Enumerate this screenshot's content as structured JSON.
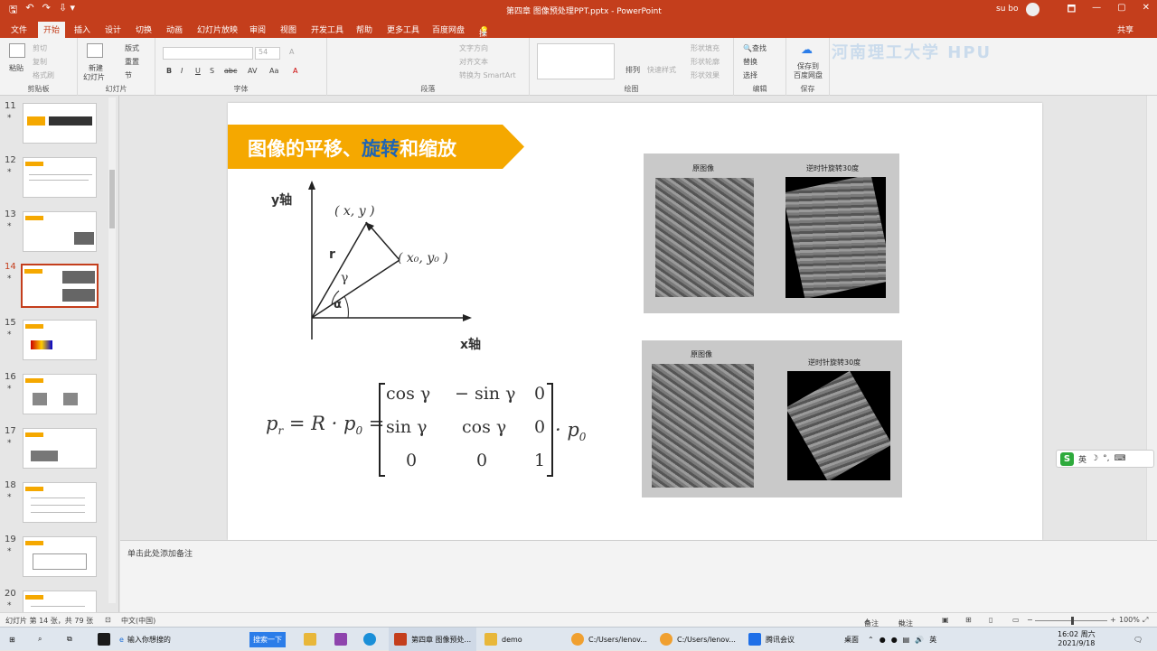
{
  "titlebar": {
    "qa_save": "🖫",
    "qa_undo": "↶",
    "qa_redo": "↷",
    "qa_more": "⇩ ▾",
    "title": "第四章 图像预处理PPT.pptx  -  PowerPoint",
    "user": "su bo",
    "win_buttons": [
      "🗖",
      "—",
      "▢",
      "✕"
    ]
  },
  "menu": {
    "items": [
      "文件",
      "开始",
      "插入",
      "设计",
      "切换",
      "动画",
      "幻灯片放映",
      "审阅",
      "视图",
      "开发工具",
      "帮助",
      "更多工具",
      "百度网盘",
      "操作说明搜索"
    ],
    "share": "共享",
    "active_index": 1
  },
  "ribbon": {
    "clipboard": {
      "name": "剪贴板",
      "paste": "粘贴",
      "cut": "剪切",
      "copy": "复制",
      "format_painter": "格式刷"
    },
    "slides": {
      "name": "幻灯片",
      "new_slide": "新建",
      "new_slide2": "幻灯片",
      "layout": "版式",
      "reset": "重置",
      "section": "节"
    },
    "font": {
      "name": "字体",
      "font_size": "54",
      "buttons": [
        "B",
        "I",
        "U",
        "S",
        "abc",
        "AV",
        "Aa",
        "A"
      ]
    },
    "paragraph": {
      "name": "段落",
      "text_direction": "文字方向",
      "align_text": "对齐文本",
      "smartart": "转换为 SmartArt"
    },
    "drawing": {
      "name": "绘图",
      "arrange": "排列",
      "quick_styles": "快速样式",
      "shape_fill": "形状填充",
      "shape_outline": "形状轮廓",
      "shape_effects": "形状效果"
    },
    "editing": {
      "name": "编辑",
      "find": "查找",
      "replace": "替换",
      "select": "选择"
    },
    "save": {
      "name": "保存",
      "label1": "保存到",
      "label2": "百度网盘"
    },
    "watermark": "河南理工大学 HPU"
  },
  "thumbnails": [
    {
      "num": "11",
      "star": "*"
    },
    {
      "num": "12",
      "star": "*"
    },
    {
      "num": "13",
      "star": "*"
    },
    {
      "num": "14",
      "star": "*"
    },
    {
      "num": "15",
      "star": "*"
    },
    {
      "num": "16",
      "star": "*"
    },
    {
      "num": "17",
      "star": "*"
    },
    {
      "num": "18",
      "star": "*"
    },
    {
      "num": "19",
      "star": "*"
    },
    {
      "num": "20",
      "star": "*"
    }
  ],
  "selected_thumbnail": "14",
  "slide": {
    "title_part1": "图像的平移、",
    "title_highlight": "旋转",
    "title_part2": "和缩放",
    "diagram": {
      "y_axis": "y轴",
      "x_axis": "x轴",
      "point": "( x, y )",
      "point0": "( x₀, y₀ )",
      "r": "r",
      "gamma": "γ",
      "alpha": "α"
    },
    "formula": {
      "lhs": "p",
      "lhs_sub": "r",
      "eq1": "= R · p",
      "eq1_sub": "0",
      "eq2": "=",
      "matrix": [
        [
          "cos γ",
          "− sin γ",
          "0"
        ],
        [
          "sin γ",
          "cos γ",
          "0"
        ],
        [
          "0",
          "0",
          "1"
        ]
      ],
      "rhs": "· p",
      "rhs_sub": "0"
    },
    "panel1": {
      "left_label": "原图像",
      "right_label": "逆时针旋转30度"
    },
    "panel2": {
      "left_label": "原图像",
      "right_label": "逆时针旋转30度"
    }
  },
  "notes_placeholder": "单击此处添加备注",
  "status": {
    "slide_info": "幻灯片 第 14 张，共 79 张",
    "language": "中文(中国)",
    "notes": "备注",
    "comments": "批注",
    "zoom": "100%"
  },
  "taskbar": {
    "search_placeholder": "输入你想搜的",
    "search_btn": "搜索一下",
    "ppt_task": "第四章 图像预处...",
    "demo_task": "demo",
    "path1": "C:/Users/lenov...",
    "path2": "C:/Users/lenov...",
    "meeting": "腾讯会议",
    "desktop": "桌面",
    "time": "16:02 周六",
    "date": "2021/9/18"
  },
  "ime": {
    "lang": "英"
  },
  "colors": {
    "accent": "#c43e1c",
    "banner": "#f5a800",
    "highlight": "#1e64b4"
  }
}
